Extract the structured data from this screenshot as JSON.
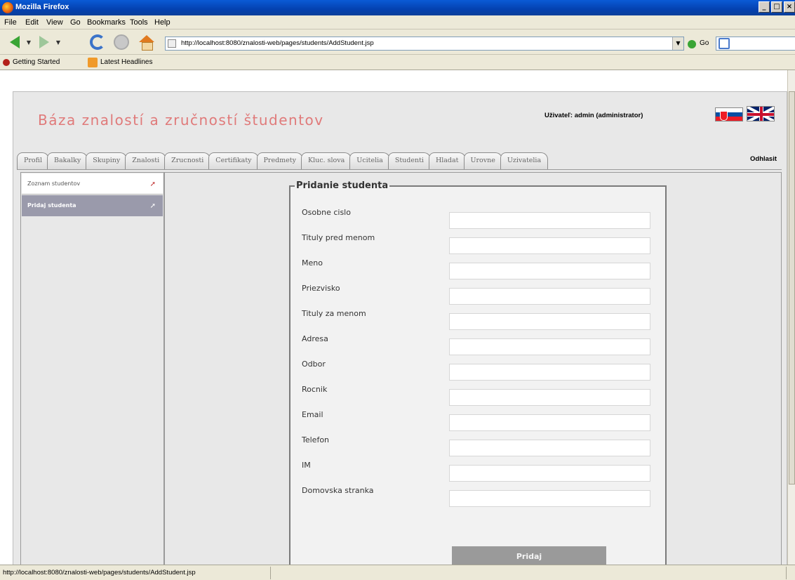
{
  "window": {
    "title": "Mozilla Firefox",
    "buttons": [
      "_",
      "□",
      "×"
    ]
  },
  "menu": [
    "File",
    "Edit",
    "View",
    "Go",
    "Bookmarks",
    "Tools",
    "Help"
  ],
  "nav": {
    "url": "http://localhost:8080/znalosti-web/pages/students/AddStudent.jsp",
    "go_label": "Go"
  },
  "bookmarks": [
    "Getting Started",
    "Latest Headlines"
  ],
  "app": {
    "title": "Báza znalostí a zručností študentov",
    "user_info": "Uživateľ: admin (administrator)",
    "logout": "Odhlasit",
    "tabs": [
      "Profil",
      "Bakalky",
      "Skupiny",
      "Znalosti",
      "Zrucnosti",
      "Certifikaty",
      "Predmety",
      "Kluc. slova",
      "Ucitelia",
      "Studenti",
      "Hladat",
      "Urovne",
      "Uzivatelia"
    ]
  },
  "sidebar": {
    "items": [
      {
        "label": "Zoznam studentov"
      },
      {
        "label": "Pridaj studenta"
      }
    ]
  },
  "form": {
    "legend": "Pridanie studenta",
    "fields": [
      "Osobne cislo",
      "Tituly pred menom",
      "Meno",
      "Priezvisko",
      "Tituly za menom",
      "Adresa",
      "Odbor",
      "Rocnik",
      "Email",
      "Telefon",
      "IM",
      "Domovska stranka"
    ],
    "submit": "Pridaj"
  },
  "status": {
    "text": "http://localhost:8080/znalosti-web/pages/students/AddStudent.jsp"
  }
}
